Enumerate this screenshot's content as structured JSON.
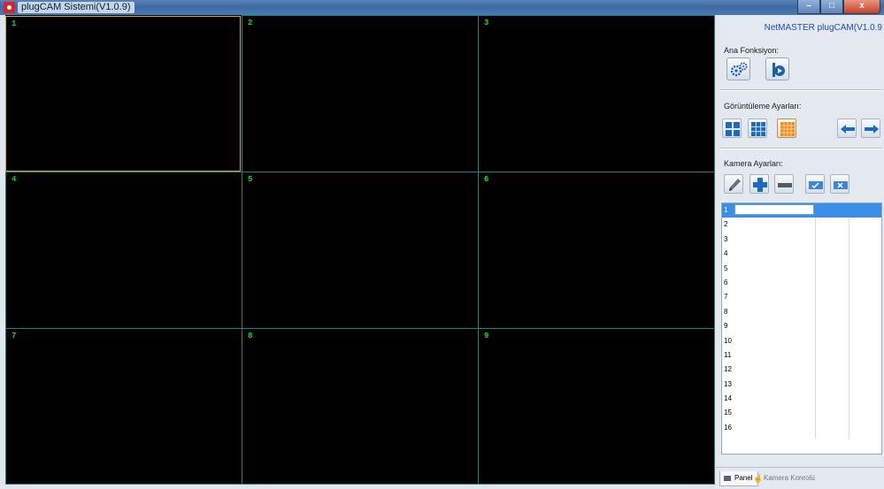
{
  "window": {
    "title": "plugCAM Sistemi(V1.0.9)",
    "min_glyph": "–",
    "max_glyph": "□",
    "close_glyph": "x"
  },
  "grid": {
    "cells": [
      {
        "label": "1",
        "selected": true
      },
      {
        "label": "2"
      },
      {
        "label": "3"
      },
      {
        "label": "4"
      },
      {
        "label": "5"
      },
      {
        "label": "6"
      },
      {
        "label": "7"
      },
      {
        "label": "8"
      },
      {
        "label": "9"
      }
    ],
    "border_color": "#1f7f7c",
    "selected_color": "#c8b40a",
    "number_color": "#19d719"
  },
  "panel": {
    "brand": "NetMASTER plugCAM(V1.0.9",
    "ana_fonksiyon": {
      "title": "Ana Fonksiyon:",
      "buttons": [
        {
          "name": "settings-gears-icon"
        },
        {
          "name": "playback-icon"
        }
      ]
    },
    "goruntuleme": {
      "title": "Görüntüleme Ayarları:",
      "buttons": [
        {
          "name": "layout-4-icon"
        },
        {
          "name": "layout-9-icon"
        },
        {
          "name": "layout-16-icon",
          "active": true
        },
        {
          "name": "arrow-left-icon"
        },
        {
          "name": "arrow-right-icon"
        }
      ]
    },
    "kamera": {
      "title": "Kamera Ayarları:",
      "buttons": [
        {
          "name": "pencil-edit-icon"
        },
        {
          "name": "plus-add-icon"
        },
        {
          "name": "minus-remove-icon"
        },
        {
          "name": "camera-connect-icon"
        },
        {
          "name": "camera-disconnect-icon"
        }
      ],
      "rows": [
        "1",
        "2",
        "3",
        "4",
        "5",
        "6",
        "7",
        "8",
        "9",
        "10",
        "11",
        "12",
        "13",
        "14",
        "15",
        "16"
      ],
      "selected_row": 0
    },
    "tabs": [
      {
        "label": "Panel",
        "active": true
      },
      {
        "label": "Kamera Konrolü",
        "active": false
      }
    ]
  }
}
